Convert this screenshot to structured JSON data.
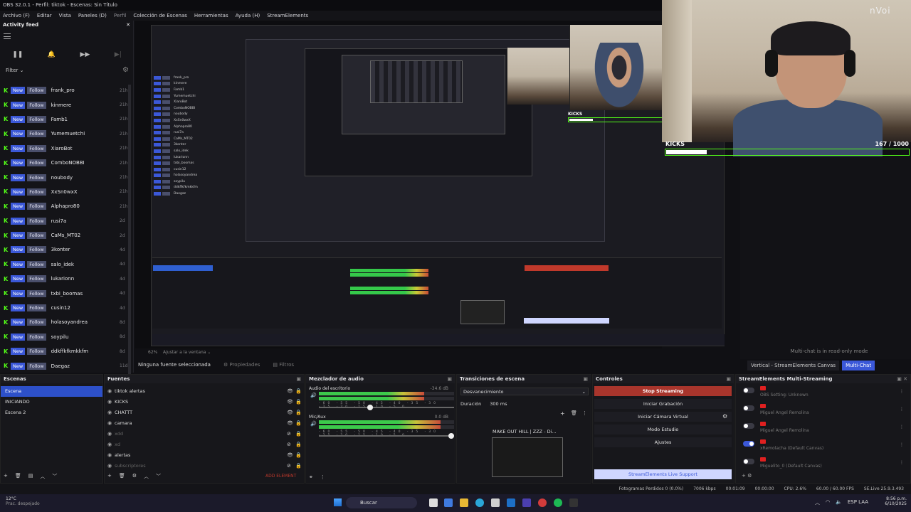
{
  "app": {
    "window_title": "OBS 32.0.1 - Perfil: tiktok - Escenas: Sin Título",
    "menu": [
      "Archivo (F)",
      "Editar",
      "Vista",
      "Paneles (D)",
      "Perfil",
      "Colección de Escenas",
      "Herramientas",
      "Ayuda (H)",
      "StreamElements"
    ]
  },
  "activity_feed": {
    "title": "Activity feed",
    "filter_label": "Filter",
    "badge_new": "New",
    "badge_follow": "Follow",
    "items": [
      {
        "name": "frank_pro",
        "time": "21h"
      },
      {
        "name": "kinmere",
        "time": "21h"
      },
      {
        "name": "Famb1",
        "time": "21h"
      },
      {
        "name": "Yumemuetchi",
        "time": "21h"
      },
      {
        "name": "XiaroBot",
        "time": "21h"
      },
      {
        "name": "ComboNOBBI",
        "time": "21h"
      },
      {
        "name": "noubody",
        "time": "21h"
      },
      {
        "name": "XxSn0wxX",
        "time": "21h"
      },
      {
        "name": "Alphapro80",
        "time": "21h"
      },
      {
        "name": "rusi7a",
        "time": "2d"
      },
      {
        "name": "CaMs_MT02",
        "time": "2d"
      },
      {
        "name": "3konter",
        "time": "4d"
      },
      {
        "name": "salo_idek",
        "time": "4d"
      },
      {
        "name": "lukarionn",
        "time": "4d"
      },
      {
        "name": "txbi_boomas",
        "time": "4d"
      },
      {
        "name": "cusin12",
        "time": "4d"
      },
      {
        "name": "holasoyandrea",
        "time": "8d"
      },
      {
        "name": "soypilu",
        "time": "8d"
      },
      {
        "name": "ddkffkfkmkkfm",
        "time": "8d"
      },
      {
        "name": "Daegaz",
        "time": "11d"
      }
    ]
  },
  "overlay": {
    "logo": "nVoi",
    "kicks_label": "KICKS",
    "kicks_count": "167 / 1000",
    "kicks_current": 167,
    "kicks_goal": 1000
  },
  "preview_bar": {
    "zoom": "62%",
    "fit": "Ajustar a la ventana"
  },
  "source_toolbar": {
    "no_source": "Ninguna fuente seleccionada",
    "properties": "Propiedades",
    "filters": "Filtros"
  },
  "multichat": {
    "readonly": "Multi-chat is in read-only mode",
    "tab_vertical": "Vertical - StreamElements Canvas",
    "tab_multichat": "Multi-Chat"
  },
  "scenes": {
    "title": "Escenas",
    "items": [
      "Escena",
      "INICIANDO",
      "Escena 2"
    ]
  },
  "sources": {
    "title": "Fuentes",
    "add_element": "ADD ELEMENT",
    "items": [
      {
        "name": "tiktok alertas",
        "visible": true
      },
      {
        "name": "KICKS",
        "visible": true
      },
      {
        "name": "CHATTT",
        "visible": true
      },
      {
        "name": "camara",
        "visible": true
      },
      {
        "name": "xdd",
        "visible": false
      },
      {
        "name": "xd",
        "visible": false
      },
      {
        "name": "alertas",
        "visible": true
      },
      {
        "name": "subscriptores",
        "visible": false
      }
    ]
  },
  "mixer": {
    "title": "Mezclador de audio",
    "channels": [
      {
        "name": "Audio del escritorio",
        "db": "-34.6 dB",
        "level": 0.78,
        "volume": 0.4
      },
      {
        "name": "Mic/Aux",
        "db": "0.0 dB",
        "level": 0.9,
        "volume": 1.0
      }
    ],
    "scale": "-60 -55 -50 -45 -40 -35 -30 -25 -20 -15 -10 -5 0"
  },
  "transitions": {
    "title": "Transiciones de escena",
    "selected": "Desvanecimiento",
    "duration_label": "Duración",
    "duration_value": "300 ms",
    "thumb_title": "MAKE OUT HILL | ZZZ - Di..."
  },
  "controls": {
    "title": "Controles",
    "stop_streaming": "Stop Streaming",
    "start_recording": "Iniciar Grabación",
    "virtual_cam": "Iniciar Cámara Virtual",
    "studio_mode": "Modo Estudio",
    "settings": "Ajustes",
    "live_support": "StreamElements Live Support"
  },
  "multistream": {
    "title": "StreamElements Multi-Streaming",
    "rows": [
      {
        "name": "OBS Setting: Unknown",
        "on": false
      },
      {
        "name": "Miguel Angel Remolina",
        "on": false
      },
      {
        "name": "Miguel Angel Remolina",
        "on": false
      },
      {
        "name": "xRemolacha (Default Canvas)",
        "on": true
      },
      {
        "name": "Miguelito_0 (Default Canvas)",
        "on": false
      }
    ]
  },
  "status": {
    "dropped": "Fotogramas Perdidos 0 (0.0%)",
    "bitrate": "7006 kbps",
    "time1": "00:01:09",
    "time2": "00:00:00",
    "cpu": "CPU: 2.6%",
    "fps": "60.00 / 60.00 FPS",
    "version": "SE.Live 25.9.3.493"
  },
  "taskbar": {
    "temp": "12°C",
    "weather": "Prac. despejado",
    "search": "Buscar",
    "lang": "ESP LAA",
    "time": "8:56 p.m.",
    "date": "6/10/2025"
  }
}
